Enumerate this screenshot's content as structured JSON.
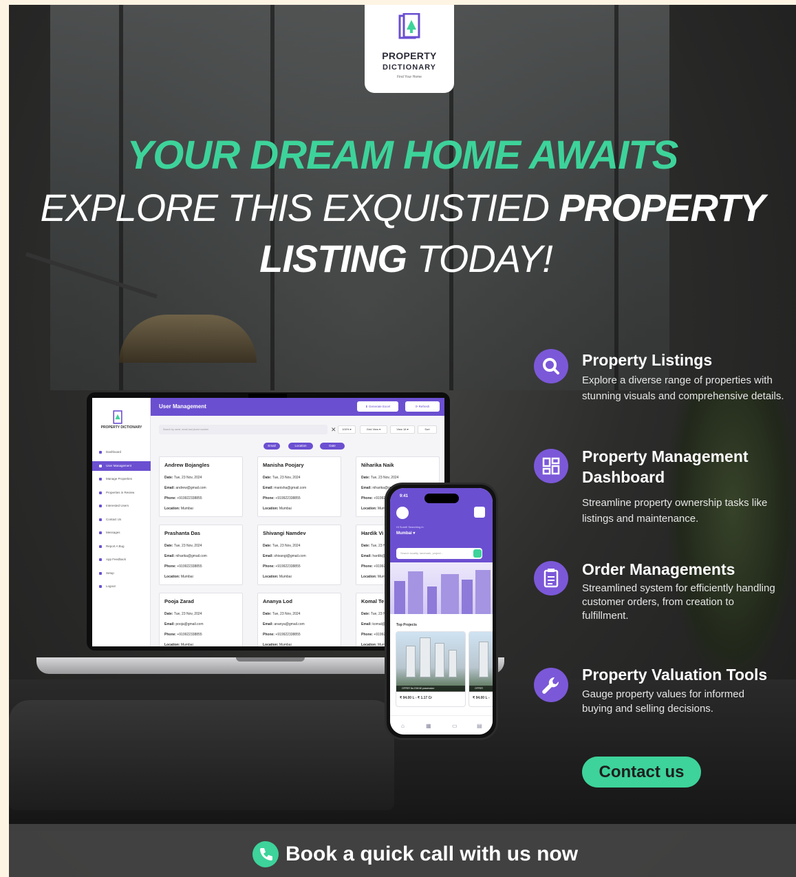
{
  "logo": {
    "line1": "PROPERTY",
    "line2": "DICTIONARY",
    "tagline": "Find Your Home",
    "brand_color": "#6b4fd1"
  },
  "hero": {
    "headline": "YOUR DREAM HOME AWAITS",
    "sub_part1": "EXPLORE THIS EXQUISTIED",
    "sub_part2": "PROPERTY",
    "sub_part3": "LISTING",
    "sub_part4": "TODAY!",
    "accent_color": "#3dd39a"
  },
  "laptop": {
    "logo_text": "PROPERTY DICTIONARY",
    "title": "User Management",
    "generate_excel": "Generate Excel",
    "refresh": "Refresh",
    "search_placeholder": "Search by name, email and phone number",
    "zoom": "100%",
    "grid_view": "Grid View",
    "view": "View 18",
    "sort": "Sort",
    "filters": [
      "Email",
      "Location",
      "Date"
    ],
    "sidebar": [
      "Dashboard",
      "User Management",
      "Manage Properties",
      "Properties in Review",
      "Interested Users",
      "Contact Us",
      "Messages",
      "Report A Bug",
      "App Feedback",
      "Setup",
      "Logout"
    ],
    "users": [
      {
        "name": "Andrew Bojangles",
        "date": "Tue, 23 Nov, 2024",
        "email": "andrew@gmail.com",
        "phone": "+919922338855",
        "location": "Mumbai"
      },
      {
        "name": "Manisha Poojary",
        "date": "Tue, 23 Nov, 2024",
        "email": "manisha@gmail.com",
        "phone": "+919922338855",
        "location": "Mumbai"
      },
      {
        "name": "Niharika Naik",
        "date": "Tue, 23 Nov, 2024",
        "email": "niharika@gmail.com",
        "phone": "+919922338855",
        "location": "Mumbai"
      },
      {
        "name": "Prashanta Das",
        "date": "Tue, 23 Nov, 2024",
        "email": "niharika@gmail.com",
        "phone": "+919922338855",
        "location": "Mumbai"
      },
      {
        "name": "Shivangi Namdev",
        "date": "Tue, 23 Nov, 2024",
        "email": "shivangi@gmail.com",
        "phone": "+919922338855",
        "location": "Mumbai"
      },
      {
        "name": "Hardik Vi",
        "date": "Tue, 23 Nov, 2024",
        "email": "hardik@gmail.com",
        "phone": "+919922338855",
        "location": "Mumbai"
      },
      {
        "name": "Pooja Zarad",
        "date": "Tue, 23 Nov, 2024",
        "email": "pooja@gmail.com",
        "phone": "+919922338855",
        "location": "Mumbai"
      },
      {
        "name": "Ananya Lod",
        "date": "Tue, 23 Nov, 2024",
        "email": "ananya@gmail.com",
        "phone": "+919922338855",
        "location": "Mumbai"
      },
      {
        "name": "Komal Te",
        "date": "Tue, 23 Nov, 2024",
        "email": "komal@gmail.com",
        "phone": "+919922338855",
        "location": "Mumbai"
      }
    ],
    "labels": {
      "date": "Date:",
      "email": "Email:",
      "phone": "Phone:",
      "location": "Location:"
    }
  },
  "phone": {
    "time": "9:41",
    "greeting": "Hi Sumit! Searching in",
    "city": "Mumbai",
    "search_placeholder": "Search locality, landmark, project...",
    "top_projects": "Top Projects",
    "offer": "OFFER  No EMI till possession",
    "price1": "₹ 94.00 L - ₹ 1.17 Cr",
    "price2": "₹ 94.00 L -"
  },
  "features": [
    {
      "title": "Property Listings",
      "desc": "Explore a diverse range of properties with stunning visuals and comprehensive details.",
      "icon": "search-icon"
    },
    {
      "title": "Property Management Dashboard",
      "desc": "Streamline property ownership tasks like listings and maintenance.",
      "icon": "dashboard-icon"
    },
    {
      "title": "Order Managements",
      "desc": "Streamlined system for efficiently handling customer orders, from creation to fulfillment.",
      "icon": "clipboard-icon"
    },
    {
      "title": "Property Valuation Tools",
      "desc": "Gauge property values for informed buying and selling decisions.",
      "icon": "wrench-icon"
    }
  ],
  "cta": {
    "contact": "Contact us",
    "call": "Book a quick call with us now"
  }
}
